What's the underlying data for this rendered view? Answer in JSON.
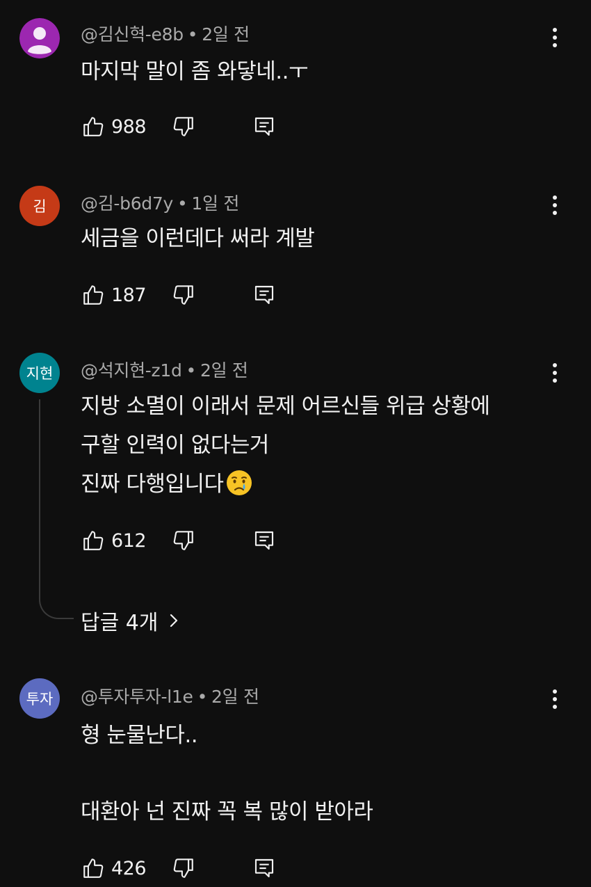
{
  "colors": {
    "background": "#0f0f0f",
    "primary_text": "#f1f1f1",
    "secondary_text": "#aaaaaa",
    "thread_line": "#3a3a3a"
  },
  "comments": [
    {
      "author": "@김신혁-e8b",
      "time": "2일 전",
      "avatar_initials": "",
      "avatar_color": "#9c27b0",
      "text": "마지막 말이 좀 와닿네..ㅜ",
      "likes": "988"
    },
    {
      "author": "@김-b6d7y",
      "time": "1일 전",
      "avatar_initials": "김",
      "avatar_color": "#c53a17",
      "text": "세금을 이런데다 써라 계발",
      "likes": "187"
    },
    {
      "author": "@석지현-z1d",
      "time": "2일 전",
      "avatar_initials": "지현",
      "avatar_color": "#00838f",
      "text_lines": [
        "지방 소멸이 이래서 문제 어르신들 위급 상황에",
        "구할 인력이 없다는거",
        "진짜 다행입니다"
      ],
      "emoji": "crying-face-emoji",
      "likes": "612",
      "replies_label": "답글 4개"
    },
    {
      "author": "@투자투자-l1e",
      "time": "2일 전",
      "avatar_initials": "투자",
      "avatar_color": "#5c6bc0",
      "text_lines": [
        "형 눈물난다..",
        "",
        "대환아 넌 진짜 꼭 복 많이 받아라"
      ],
      "likes": "426"
    }
  ],
  "meta_separator": "•",
  "icons": {
    "like": "thumbs-up-icon",
    "dislike": "thumbs-down-icon",
    "reply": "reply-icon",
    "more": "more-vertical-icon",
    "chevron": "chevron-right-icon"
  }
}
